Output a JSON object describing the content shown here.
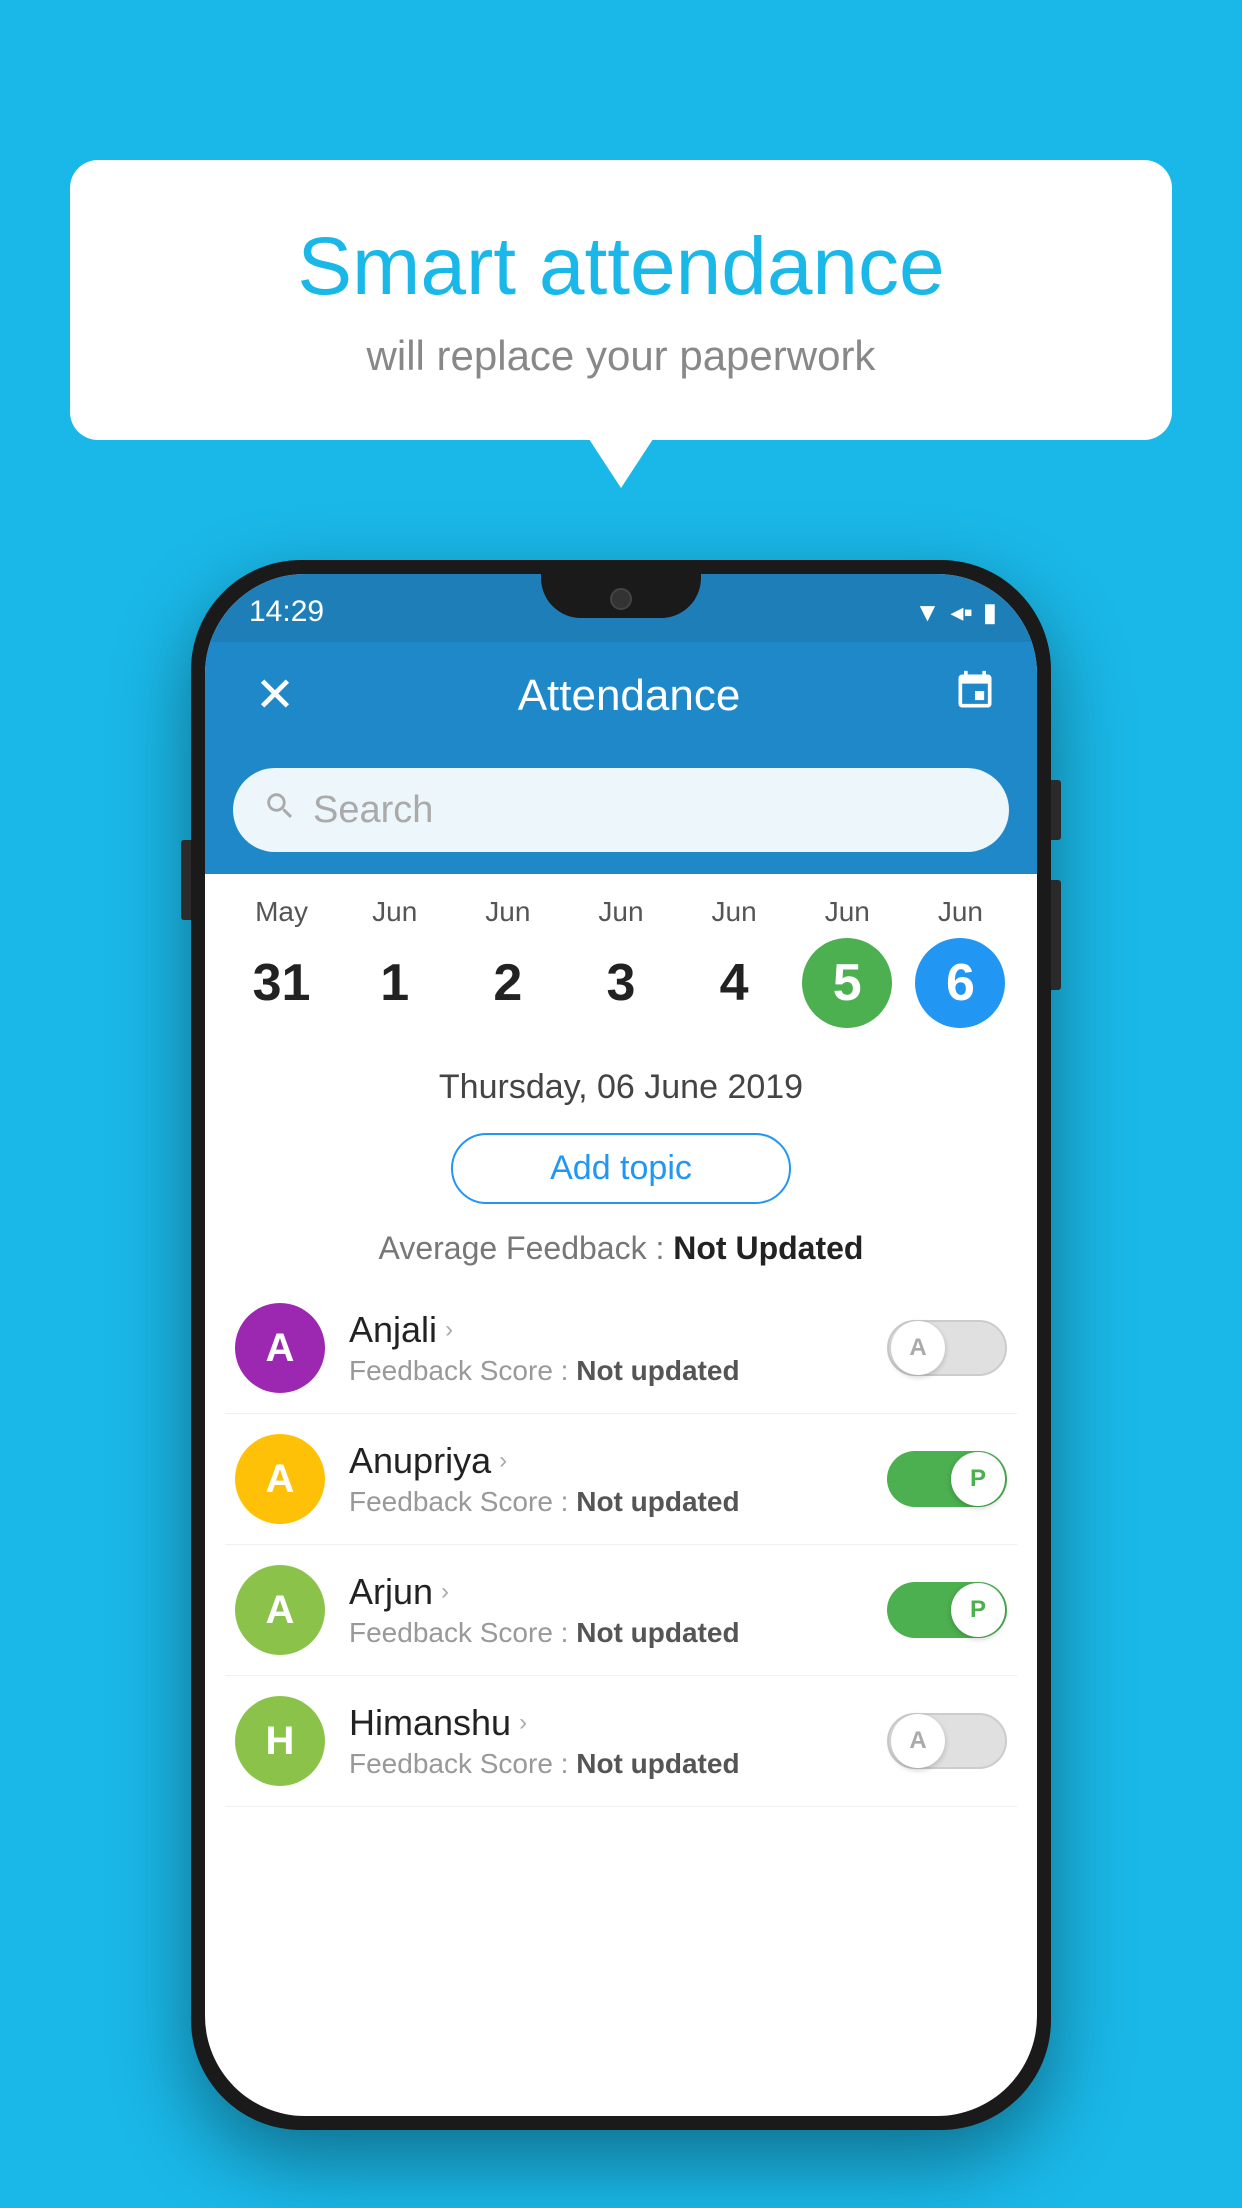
{
  "background": "#1ab8e8",
  "bubble": {
    "title": "Smart attendance",
    "subtitle": "will replace your paperwork"
  },
  "phone": {
    "status_time": "14:29",
    "top_bar": {
      "close_label": "✕",
      "title": "Attendance",
      "calendar_icon": "📅"
    },
    "search": {
      "placeholder": "Search"
    },
    "calendar": {
      "days": [
        {
          "month": "May",
          "num": "31",
          "style": "normal"
        },
        {
          "month": "Jun",
          "num": "1",
          "style": "normal"
        },
        {
          "month": "Jun",
          "num": "2",
          "style": "normal"
        },
        {
          "month": "Jun",
          "num": "3",
          "style": "normal"
        },
        {
          "month": "Jun",
          "num": "4",
          "style": "normal"
        },
        {
          "month": "Jun",
          "num": "5",
          "style": "green"
        },
        {
          "month": "Jun",
          "num": "6",
          "style": "blue"
        }
      ]
    },
    "selected_date": "Thursday, 06 June 2019",
    "add_topic_label": "Add topic",
    "avg_feedback_label": "Average Feedback :",
    "avg_feedback_value": "Not Updated",
    "students": [
      {
        "name": "Anjali",
        "avatar_letter": "A",
        "avatar_color": "#9c27b0",
        "feedback": "Not updated",
        "toggle": "absent",
        "toggle_label": "A"
      },
      {
        "name": "Anupriya",
        "avatar_letter": "A",
        "avatar_color": "#ffc107",
        "feedback": "Not updated",
        "toggle": "present",
        "toggle_label": "P"
      },
      {
        "name": "Arjun",
        "avatar_letter": "A",
        "avatar_color": "#8bc34a",
        "feedback": "Not updated",
        "toggle": "present",
        "toggle_label": "P"
      },
      {
        "name": "Himanshu",
        "avatar_letter": "H",
        "avatar_color": "#8bc34a",
        "feedback": "Not updated",
        "toggle": "absent",
        "toggle_label": "A"
      }
    ],
    "feedback_label": "Feedback Score :"
  }
}
